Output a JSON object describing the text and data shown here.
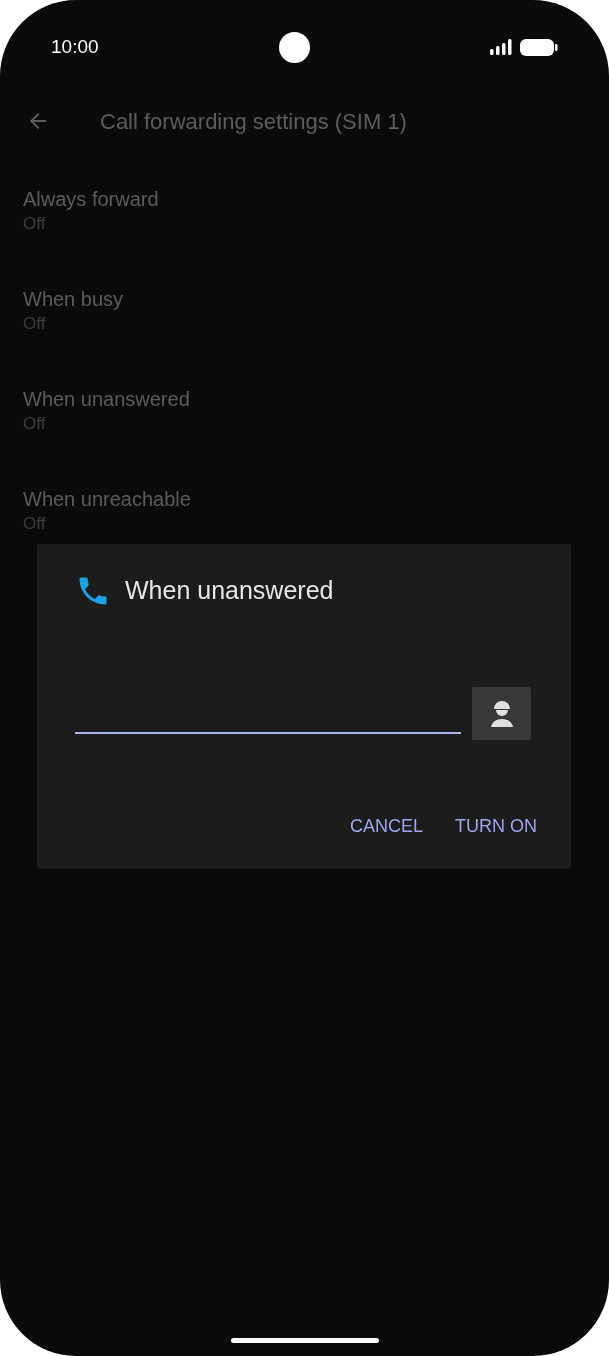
{
  "status_bar": {
    "time": "10:00"
  },
  "app_bar": {
    "title": "Call forwarding settings (SIM 1)"
  },
  "settings": [
    {
      "title": "Always forward",
      "summary": "Off"
    },
    {
      "title": "When busy",
      "summary": "Off"
    },
    {
      "title": "When unanswered",
      "summary": "Off"
    },
    {
      "title": "When unreachable",
      "summary": "Off"
    }
  ],
  "dialog": {
    "title": "When unanswered",
    "buttons": [
      "CANCEL",
      "TURN ON"
    ]
  }
}
